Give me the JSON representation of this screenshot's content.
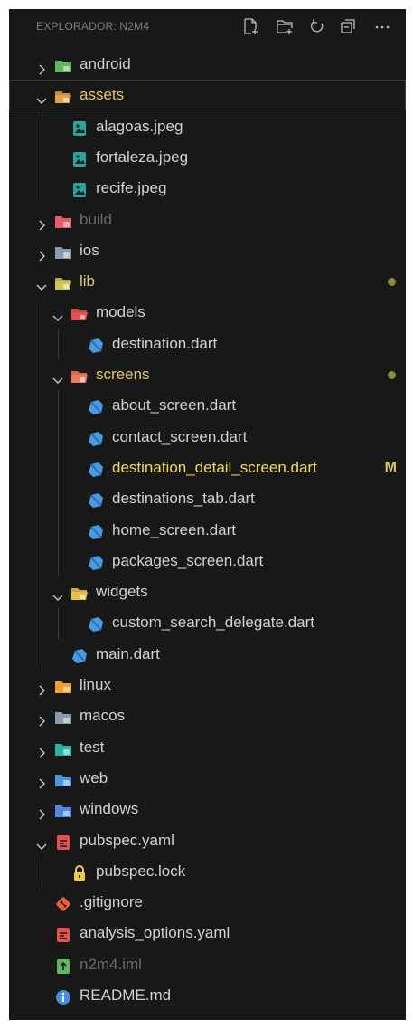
{
  "explorer": {
    "title": "EXPLORADOR: N2M4",
    "actions": [
      "new-file",
      "new-folder",
      "refresh",
      "collapse-all",
      "more"
    ]
  },
  "tree": [
    {
      "label": "android",
      "type": "folder",
      "icon": "android-folder-icon",
      "color": "#5fb85f",
      "expanded": false
    },
    {
      "label": "assets",
      "type": "folder",
      "icon": "assets-folder-icon",
      "color": "#e0a04a",
      "expanded": true,
      "selected": true,
      "style": "yellow"
    },
    {
      "label": "alagoas.jpeg",
      "type": "file",
      "icon": "image-file-icon",
      "color": "#26a69a"
    },
    {
      "label": "fortaleza.jpeg",
      "type": "file",
      "icon": "image-file-icon",
      "color": "#26a69a"
    },
    {
      "label": "recife.jpeg",
      "type": "file",
      "icon": "image-file-icon",
      "color": "#26a69a"
    },
    {
      "label": "build",
      "type": "folder",
      "icon": "build-folder-icon",
      "color": "#e85a6a",
      "expanded": false,
      "style": "dim"
    },
    {
      "label": "ios",
      "type": "folder",
      "icon": "ios-folder-icon",
      "color": "#8a9bb0",
      "expanded": false
    },
    {
      "label": "lib",
      "type": "folder",
      "icon": "lib-folder-icon",
      "color": "#d0c35a",
      "expanded": true,
      "style": "yellow",
      "status": "dot"
    },
    {
      "label": "models",
      "type": "folder",
      "icon": "models-folder-icon",
      "color": "#e84f4f",
      "expanded": true
    },
    {
      "label": "destination.dart",
      "type": "file",
      "icon": "dart-file-icon",
      "color": "#4a9ae0"
    },
    {
      "label": "screens",
      "type": "folder",
      "icon": "screens-folder-icon",
      "color": "#f07c5a",
      "expanded": true,
      "style": "yellow",
      "status": "dot"
    },
    {
      "label": "about_screen.dart",
      "type": "file",
      "icon": "dart-file-icon",
      "color": "#4a9ae0"
    },
    {
      "label": "contact_screen.dart",
      "type": "file",
      "icon": "dart-file-icon",
      "color": "#4a9ae0"
    },
    {
      "label": "destination_detail_screen.dart",
      "type": "file",
      "icon": "dart-file-icon",
      "color": "#4a9ae0",
      "style": "bright-yellow",
      "status": "M"
    },
    {
      "label": "destinations_tab.dart",
      "type": "file",
      "icon": "dart-file-icon",
      "color": "#4a9ae0"
    },
    {
      "label": "home_screen.dart",
      "type": "file",
      "icon": "dart-file-icon",
      "color": "#4a9ae0"
    },
    {
      "label": "packages_screen.dart",
      "type": "file",
      "icon": "dart-file-icon",
      "color": "#4a9ae0"
    },
    {
      "label": "widgets",
      "type": "folder",
      "icon": "widgets-folder-icon",
      "color": "#e5c14a",
      "expanded": true
    },
    {
      "label": "custom_search_delegate.dart",
      "type": "file",
      "icon": "dart-file-icon",
      "color": "#4a9ae0"
    },
    {
      "label": "main.dart",
      "type": "file",
      "icon": "dart-file-icon",
      "color": "#4a9ae0"
    },
    {
      "label": "linux",
      "type": "folder",
      "icon": "linux-folder-icon",
      "color": "#f0a030",
      "expanded": false
    },
    {
      "label": "macos",
      "type": "folder",
      "icon": "macos-folder-icon",
      "color": "#8a9aa8",
      "expanded": false
    },
    {
      "label": "test",
      "type": "folder",
      "icon": "test-folder-icon",
      "color": "#26b5a0",
      "expanded": false
    },
    {
      "label": "web",
      "type": "folder",
      "icon": "web-folder-icon",
      "color": "#4a9ae0",
      "expanded": false
    },
    {
      "label": "windows",
      "type": "folder",
      "icon": "windows-folder-icon",
      "color": "#4a8ae0",
      "expanded": false
    },
    {
      "label": "pubspec.yaml",
      "type": "file",
      "icon": "yaml-file-icon",
      "color": "#e84f4f",
      "expandable": true,
      "expanded": true
    },
    {
      "label": "pubspec.lock",
      "type": "file",
      "icon": "lock-icon",
      "color": "#f2c94c"
    },
    {
      "label": ".gitignore",
      "type": "file",
      "icon": "git-icon",
      "color": "#e8603c"
    },
    {
      "label": "analysis_options.yaml",
      "type": "file",
      "icon": "yaml-file-icon",
      "color": "#e84f4f"
    },
    {
      "label": "n2m4.iml",
      "type": "file",
      "icon": "iml-file-icon",
      "color": "#5fb85f",
      "style": "dim"
    },
    {
      "label": "README.md",
      "type": "file",
      "icon": "info-icon",
      "color": "#4a8ae0"
    }
  ]
}
